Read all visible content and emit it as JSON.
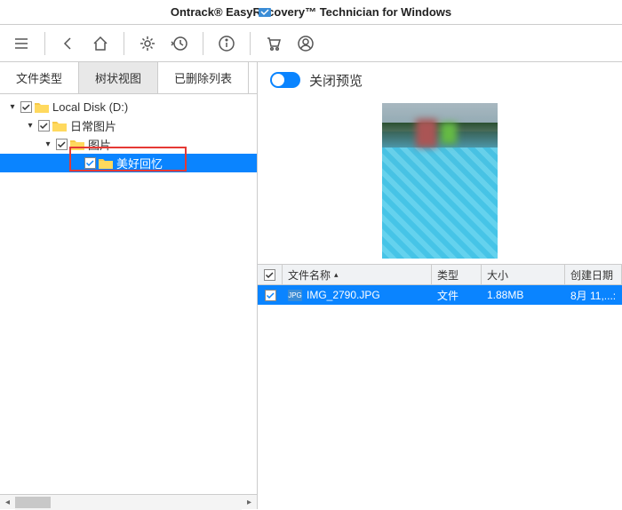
{
  "title": "Ontrack® EasyRecovery™ Technician for Windows",
  "tabs": {
    "file_type": "文件类型",
    "tree_view": "树状视图",
    "deleted": "已删除列表"
  },
  "tree": {
    "n0": {
      "label": "Local Disk (D:)"
    },
    "n1": {
      "label": "日常图片"
    },
    "n2": {
      "label": "图片"
    },
    "n3": {
      "label": "美好回忆"
    }
  },
  "preview_toggle_label": "关闭预览",
  "columns": {
    "name": "文件名称",
    "type": "类型",
    "size": "大小",
    "date": "创建日期"
  },
  "file": {
    "icon_text": "JPG",
    "name": "IMG_2790.JPG",
    "type": "文件",
    "size": "1.88MB",
    "date": "8月 11,...:"
  }
}
